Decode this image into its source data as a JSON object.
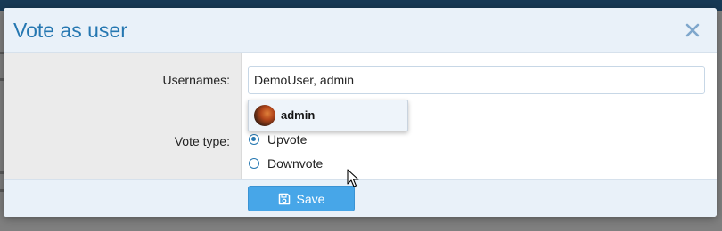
{
  "dialog": {
    "title": "Vote as user",
    "close_icon": "close-icon"
  },
  "form": {
    "usernames_label": "Usernames:",
    "usernames_value": "DemoUser, admin",
    "vote_type_label": "Vote type:",
    "vote_options": [
      {
        "label": "Upvote",
        "checked": true
      },
      {
        "label": "Downvote",
        "checked": false
      }
    ]
  },
  "autocomplete": {
    "items": [
      {
        "name": "admin",
        "icon": "avatar"
      }
    ]
  },
  "footer": {
    "save_label": "Save",
    "save_icon": "save-icon"
  },
  "colors": {
    "title": "#2577b1",
    "header_bg": "#e9f1f9",
    "primary_button": "#47a6e8",
    "page_header": "#183a56"
  }
}
